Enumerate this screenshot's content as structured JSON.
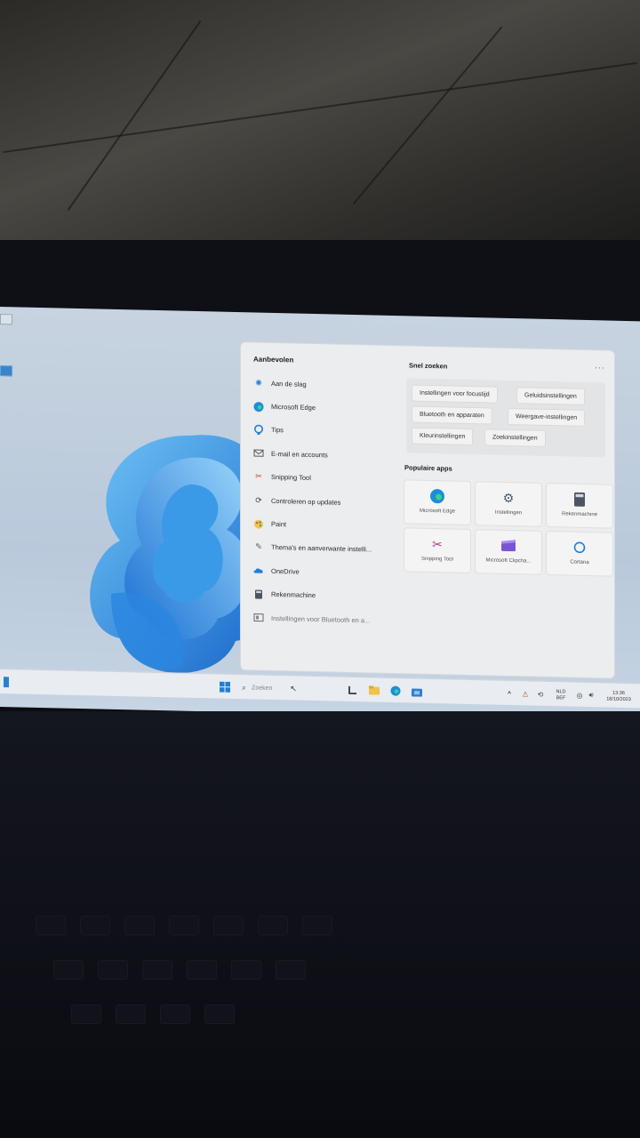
{
  "start_menu": {
    "recommended_title": "Aanbevolen",
    "recommended": [
      {
        "label": "Aan de slag",
        "icon": "get-started-icon"
      },
      {
        "label": "Microsoft Edge",
        "icon": "edge-icon"
      },
      {
        "label": "Tips",
        "icon": "tips-icon"
      },
      {
        "label": "E-mail en accounts",
        "icon": "mail-icon"
      },
      {
        "label": "Snipping Tool",
        "icon": "snipping-tool-icon"
      },
      {
        "label": "Controleren op updates",
        "icon": "update-icon"
      },
      {
        "label": "Paint",
        "icon": "paint-icon"
      },
      {
        "label": "Thema's en aanverwante instelli...",
        "icon": "brush-icon"
      },
      {
        "label": "OneDrive",
        "icon": "onedrive-icon"
      },
      {
        "label": "Rekenmachine",
        "icon": "calculator-icon"
      },
      {
        "label": "Instellingen voor Bluetooth en a...",
        "icon": "bluetooth-settings-icon"
      }
    ],
    "quick_search_title": "Snel zoeken",
    "more": "···",
    "quick_search": [
      "Instellingen voor focustijd",
      "Geluidsinstellingen",
      "Bluetooth en apparaten",
      "Weergave-instellingen",
      "Kleurinstellingen",
      "Zoekinstellingen"
    ],
    "popular_title": "Populaire apps",
    "popular_apps": [
      {
        "label": "Microsoft Edge",
        "icon": "edge-icon"
      },
      {
        "label": "Instellingen",
        "icon": "settings-gear-icon"
      },
      {
        "label": "Rekenmachine",
        "icon": "calculator-icon"
      },
      {
        "label": "Snipping Tool",
        "icon": "snipping-tool-icon"
      },
      {
        "label": "Microsoft Clipcha...",
        "icon": "clipchamp-icon"
      },
      {
        "label": "Cortana",
        "icon": "cortana-icon"
      }
    ]
  },
  "taskbar": {
    "search_placeholder": "Zoeken",
    "language": "NLD",
    "keyboard": "BEF",
    "time": "13:36",
    "date": "18/10/2023"
  },
  "colors": {
    "accent": "#1f7fd8",
    "wallpaper": "#c7d3e0",
    "menu_bg": "#ecedef"
  }
}
